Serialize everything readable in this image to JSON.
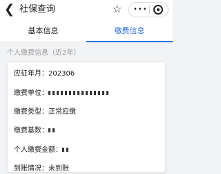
{
  "header": {
    "back_icon": "chevron-left-icon",
    "title": "社保查询",
    "star_icon": "star-outline-icon",
    "more_icon": "more-dots-icon",
    "more_label": "•••",
    "close_icon": "target-circle-icon"
  },
  "tabs": [
    {
      "label": "基本信息",
      "active": false
    },
    {
      "label": "缴费信息",
      "active": true
    }
  ],
  "colors": {
    "accent": "#2f73d8"
  },
  "section_title": "个人缴费信息（近2年）",
  "record": {
    "period_label": "应征年月：",
    "period_value": "202306",
    "unit_label": "缴费单位：",
    "type_label": "缴费类型：",
    "type_value": "正常应缴",
    "base_label": "缴费基数：",
    "amount_label": "个人缴费金额：",
    "next_label": "到账情况：",
    "next_value": "未到账"
  }
}
